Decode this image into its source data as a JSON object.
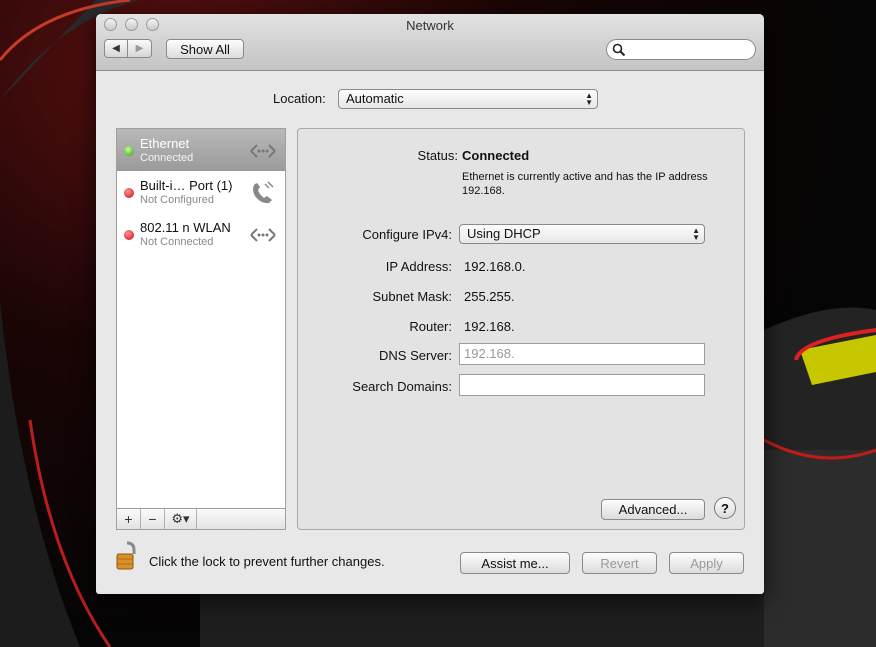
{
  "window": {
    "title": "Network"
  },
  "toolbar": {
    "show_all": "Show All",
    "search_placeholder": ""
  },
  "location": {
    "label": "Location:",
    "value": "Automatic"
  },
  "services": [
    {
      "name": "Ethernet",
      "status": "Connected",
      "indicator": "green",
      "icon": "ethernet-icon"
    },
    {
      "name": "Built-i… Port (1)",
      "status": "Not Configured",
      "indicator": "red",
      "icon": "phone-icon"
    },
    {
      "name": "802.11 n WLAN",
      "status": "Not Connected",
      "indicator": "red",
      "icon": "ethernet-icon"
    }
  ],
  "sidebar_buttons": {
    "add": "+",
    "remove": "−",
    "gear": "⚙▾"
  },
  "detail": {
    "status_label": "Status:",
    "status_value": "Connected",
    "status_description": "Ethernet is currently active and has the IP address 192.168.",
    "configure_label": "Configure IPv4:",
    "configure_value": "Using DHCP",
    "ip_label": "IP Address:",
    "ip_value": "192.168.0.",
    "subnet_label": "Subnet Mask:",
    "subnet_value": "255.255.",
    "router_label": "Router:",
    "router_value": "192.168.",
    "dns_label": "DNS Server:",
    "dns_value": "192.168.",
    "search_domains_label": "Search Domains:",
    "search_domains_value": "",
    "advanced_button": "Advanced...",
    "help_button": "?"
  },
  "footer": {
    "lock_text": "Click the lock to prevent further changes.",
    "assist_button": "Assist me...",
    "revert_button": "Revert",
    "apply_button": "Apply"
  },
  "colors": {
    "connected": "#2e9a10",
    "disconnected": "#cc0000"
  }
}
